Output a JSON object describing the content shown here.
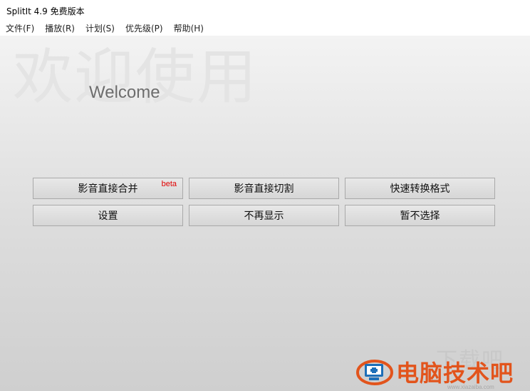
{
  "window": {
    "title": "SplitIt 4.9 免费版本"
  },
  "menu": {
    "items": [
      {
        "label": "文件(F)"
      },
      {
        "label": "播放(R)"
      },
      {
        "label": "计划(S)"
      },
      {
        "label": "优先级(P)"
      },
      {
        "label": "帮助(H)"
      }
    ]
  },
  "welcome": {
    "zh": "欢迎使用",
    "en": "Welcome"
  },
  "buttons": {
    "merge": {
      "label": "影音直接合并",
      "badge": "beta"
    },
    "split": {
      "label": "影音直接切割"
    },
    "convert": {
      "label": "快速转换格式"
    },
    "settings": {
      "label": "设置"
    },
    "no_more": {
      "label": "不再显示"
    },
    "later": {
      "label": "暂不选择"
    }
  },
  "watermark": {
    "text": "电脑技术吧",
    "faint": "下载吧",
    "url": "www.xiazaiba.com",
    "colors": {
      "text": "#e2541c",
      "logo_blue": "#1d6fb8"
    }
  }
}
